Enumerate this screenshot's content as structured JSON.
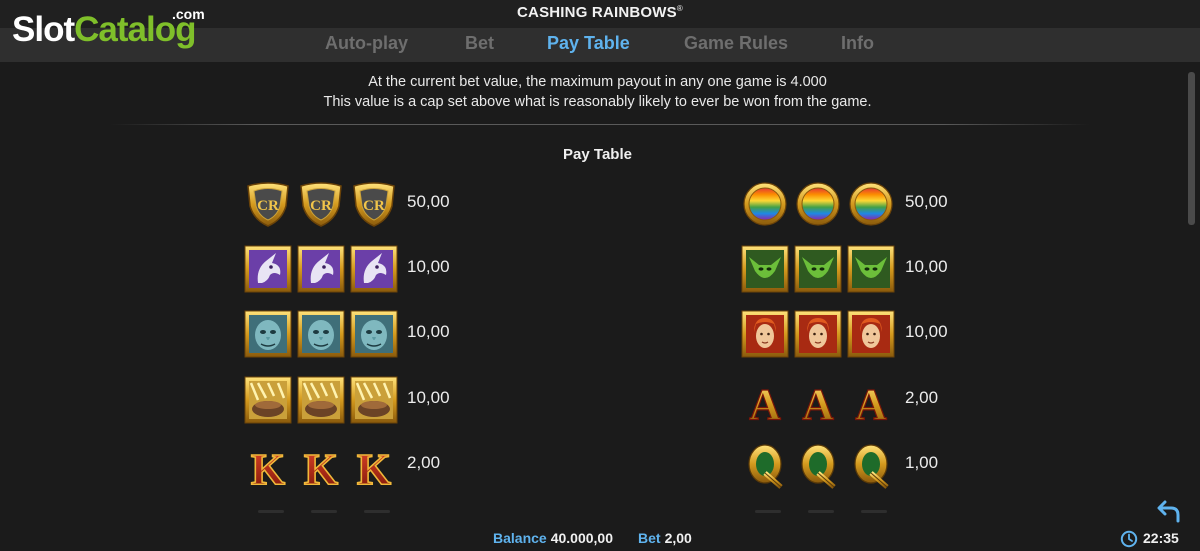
{
  "header": {
    "title": "CASHING RAINBOWS",
    "title_mark": "®",
    "logo": {
      "slot": "Slot",
      "catalog": "Catalog",
      "dotcom": ".com"
    }
  },
  "tabs": [
    {
      "label": "Auto-play",
      "active": false
    },
    {
      "label": "Bet",
      "active": false
    },
    {
      "label": "Pay Table",
      "active": true
    },
    {
      "label": "Game Rules",
      "active": false
    },
    {
      "label": "Info",
      "active": false
    }
  ],
  "notice": {
    "line1": "At the current bet value, the maximum payout in any one game is 4.000",
    "line2": "This value is a cap set above what is reasonably likely to ever be won from the game."
  },
  "section_title": "Pay Table",
  "paytable": {
    "left": [
      {
        "symbol": "gold-shield-cr-symbol",
        "payout": "50,00"
      },
      {
        "symbol": "unicorn-symbol",
        "payout": "10,00"
      },
      {
        "symbol": "troll-symbol",
        "payout": "10,00"
      },
      {
        "symbol": "gold-cauldron-symbol",
        "payout": "10,00"
      },
      {
        "symbol": "letter-k-symbol",
        "payout": "2,00"
      }
    ],
    "right": [
      {
        "symbol": "rainbow-coin-symbol",
        "payout": "50,00"
      },
      {
        "symbol": "elf-symbol",
        "payout": "10,00"
      },
      {
        "symbol": "redhead-man-symbol",
        "payout": "10,00"
      },
      {
        "symbol": "letter-a-symbol",
        "payout": "2,00"
      },
      {
        "symbol": "letter-q-symbol",
        "payout": "1,00"
      }
    ]
  },
  "footer": {
    "balance_label": "Balance",
    "balance_value": "40.000,00",
    "bet_label": "Bet",
    "bet_value": "2,00",
    "time": "22:35"
  },
  "colors": {
    "accent": "#5fb3ee",
    "logo_green": "#7fbf2a",
    "gold": "#d4a22a",
    "background": "#1b1b1b"
  }
}
